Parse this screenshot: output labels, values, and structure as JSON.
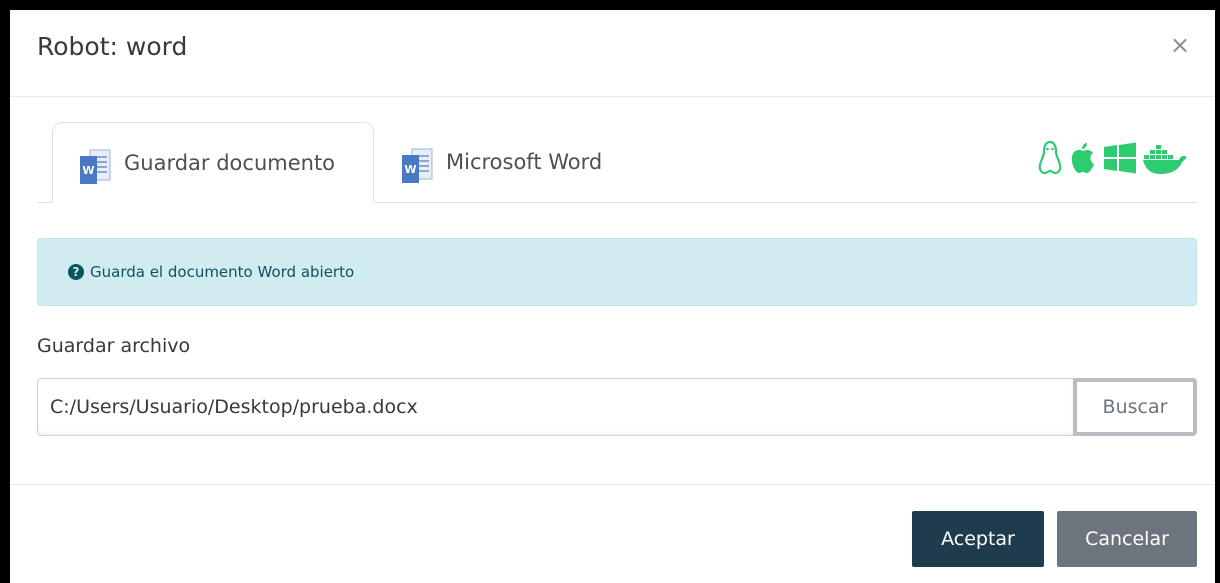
{
  "modal": {
    "title": "Robot: word",
    "close_symbol": "×"
  },
  "tabs": [
    {
      "label": "Guardar documento",
      "icon": "word-icon",
      "active": true
    },
    {
      "label": "Microsoft Word",
      "icon": "word-icon",
      "active": false
    }
  ],
  "os_support": {
    "icons": [
      "linux-icon",
      "apple-icon",
      "windows-icon",
      "docker-icon"
    ],
    "color": "#2ecc71"
  },
  "info": {
    "icon": "question-circle-icon",
    "text": "Guarda el documento Word abierto"
  },
  "form": {
    "field_label": "Guardar archivo",
    "file_path": "C:/Users/Usuario/Desktop/prueba.docx",
    "browse_label": "Buscar"
  },
  "footer": {
    "accept_label": "Aceptar",
    "cancel_label": "Cancelar"
  },
  "colors": {
    "accept": "#1f3c4f",
    "cancel": "#6c757d",
    "info_bg": "#d1ecf1"
  }
}
